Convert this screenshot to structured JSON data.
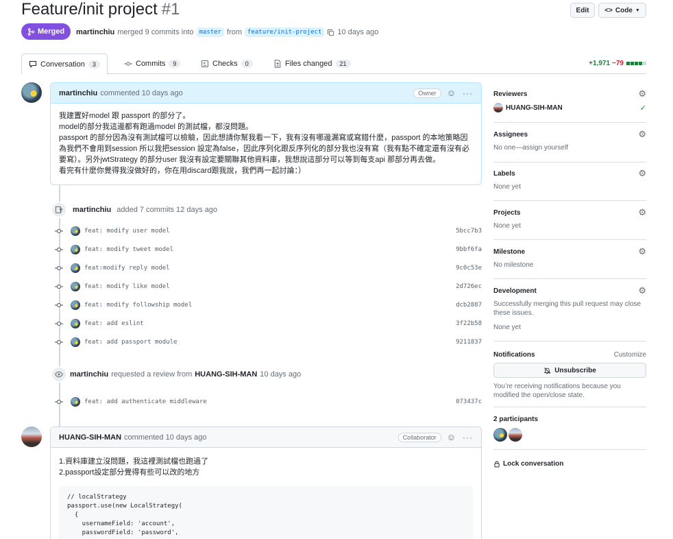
{
  "pr": {
    "title": "Feature/init project",
    "number": "#1",
    "edit_label": "Edit",
    "code_label": "Code",
    "status": "Merged",
    "author": "martinchiu",
    "merge_text": "merged 9 commits into",
    "base_branch": "master",
    "from_text": "from",
    "head_branch": "feature/init-project",
    "time": "10 days ago"
  },
  "tabs": [
    {
      "label": "Conversation",
      "count": "3"
    },
    {
      "label": "Commits",
      "count": "9"
    },
    {
      "label": "Checks",
      "count": "0"
    },
    {
      "label": "Files changed",
      "count": "21"
    }
  ],
  "diffstat": {
    "additions": "+1,971",
    "deletions": "−79"
  },
  "comment1": {
    "author": "martinchiu",
    "action": "commented 10 days ago",
    "role": "Owner",
    "lines": [
      "我建置好model 跟 passport 的部分了。",
      "model的部分我這邊都有跑過model 的測試檔，都沒問題。",
      "passport 的部分因為沒有測試檔可以檢驗，因此想請你幫我看一下，我有沒有哪邊漏寫或寫錯什麼，passport 的本地策略因為我們不會用到session 所以我把session 設定為false，因此序列化跟反序列化的部分我也沒有寫（我有點不確定還有沒有必要寫）。另外jwtStrategy 的部分user 我沒有設定要關聯其他資料庫，我想說這部分可以等到每支api 那部分再去做。",
      "看完有什麼你覺得我沒做好的，你在用discard跟我說，我們再一起討論：）"
    ]
  },
  "event_commits": {
    "author": "martinchiu",
    "text": "added 7 commits 12 days ago"
  },
  "commits": [
    {
      "msg": "feat: modify user model",
      "sha": "5bcc7b3"
    },
    {
      "msg": "feat: modify tweet model",
      "sha": "9bbf6fa"
    },
    {
      "msg": "feat:modify reply model",
      "sha": "9c0c53e"
    },
    {
      "msg": "feat: modify like model",
      "sha": "2d726ec"
    },
    {
      "msg": "feat: modify followship model",
      "sha": "dcb2887"
    },
    {
      "msg": "feat: add eslint",
      "sha": "3f22b58"
    },
    {
      "msg": "feat: add passport module",
      "sha": "9211837"
    }
  ],
  "event_review": {
    "author": "martinchiu",
    "text": "requested a review from",
    "reviewer": "HUANG-SIH-MAN",
    "time": "10 days ago"
  },
  "commit_after": {
    "msg": "feat: add authenticate middleware",
    "sha": "073437c"
  },
  "comment2": {
    "author": "HUANG-SIH-MAN",
    "action": "commented 10 days ago",
    "role": "Collaborator",
    "lines": [
      "1.資料庫建立沒問題，我這裡測試檔也跑過了",
      "2.passport設定部分覺得有些可以改的地方"
    ],
    "code": "// localStrategy\npassport.use(new LocalStrategy(\n  {\n    usernameField: 'account',\n    passwordField: 'password',"
  },
  "sidebar": {
    "reviewers_title": "Reviewers",
    "reviewer_name": "HUANG-SIH-MAN",
    "assignees_title": "Assignees",
    "assignees_text": "No one—assign yourself",
    "labels_title": "Labels",
    "labels_text": "None yet",
    "projects_title": "Projects",
    "projects_text": "None yet",
    "milestone_title": "Milestone",
    "milestone_text": "No milestone",
    "development_title": "Development",
    "development_text": "Successfully merging this pull request may close these issues.",
    "development_none": "None yet",
    "notifications_title": "Notifications",
    "customize": "Customize",
    "unsubscribe": "Unsubscribe",
    "notifications_text": "You’re receiving notifications because you modified the open/close state.",
    "participants_title": "2 participants",
    "lock": "Lock conversation"
  },
  "colors": {
    "merged": "#8250df",
    "link": "#0969da",
    "add": "#1a7f37",
    "del": "#cf222e"
  }
}
